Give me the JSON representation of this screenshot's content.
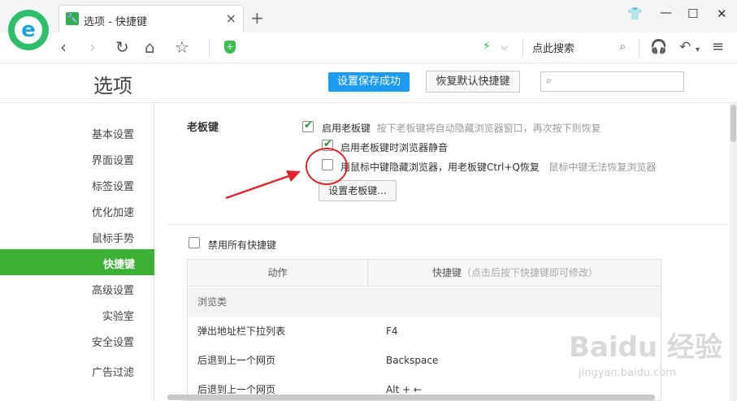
{
  "browser": {
    "tab_title": "选项 - 快捷键",
    "tab_close": "×",
    "new_tab": "+",
    "search_placeholder": "点此搜索"
  },
  "page": {
    "title": "选项",
    "save_success": "设置保存成功",
    "restore_default": "恢复默认快捷键"
  },
  "sidebar": {
    "items": [
      {
        "label": "基本设置"
      },
      {
        "label": "界面设置"
      },
      {
        "label": "标签设置"
      },
      {
        "label": "优化加速"
      },
      {
        "label": "鼠标手势"
      },
      {
        "label": "快捷键",
        "active": true
      },
      {
        "label": "高级设置"
      },
      {
        "label": "实验室"
      },
      {
        "label": "安全设置"
      },
      {
        "label": "广告过滤"
      }
    ]
  },
  "boss_key": {
    "section_title": "老板键",
    "enable_label": "启用老板键",
    "enable_hint": "按下老板键将自动隐藏浏览器窗口，再次按下则恢复",
    "enable_checked": true,
    "mute_label": "启用老板键时浏览器静音",
    "mute_checked": true,
    "middle_label": "用鼠标中键隐藏浏览器，用老板键Ctrl+Q恢复",
    "middle_hint": "鼠标中键无法恢复浏览器",
    "middle_checked": false,
    "set_button": "设置老板键..."
  },
  "shortcuts": {
    "disable_all_label": "禁用所有快捷键",
    "disable_all_checked": false,
    "col_action": "动作",
    "col_key": "快捷键",
    "col_key_hint": "（点击后按下快捷键即可修改）",
    "group": "浏览类",
    "rows": [
      {
        "action": "弹出地址栏下拉列表",
        "key": "F4"
      },
      {
        "action": "后退到上一个网页",
        "key": "Backspace"
      },
      {
        "action": "后退到上一个网页",
        "key": "Alt + ←"
      }
    ]
  },
  "watermark": {
    "brand": "Baidu 经验",
    "url": "jingyan.baidu.com"
  },
  "colors": {
    "accent_green": "#3cb034",
    "save_blue": "#1d9bf0",
    "annotation_red": "#e0252a"
  }
}
